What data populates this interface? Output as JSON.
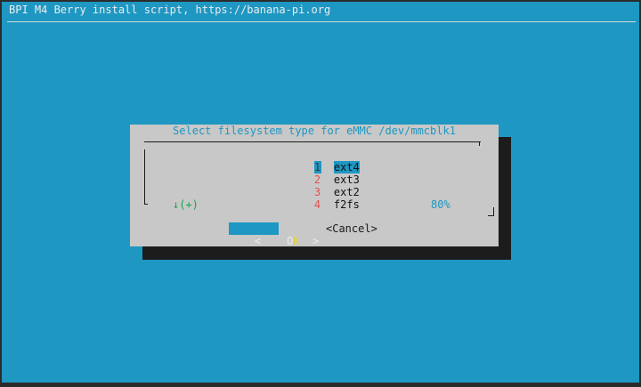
{
  "backtitle": "BPI M4 Berry install script, https://banana-pi.org",
  "dialog": {
    "title": "Select filesystem type for eMMC /dev/mmcblk1",
    "items": [
      {
        "tag": "1",
        "label": "ext4",
        "selected": true
      },
      {
        "tag": "2",
        "label": "ext3",
        "selected": false
      },
      {
        "tag": "3",
        "label": "ext2",
        "selected": false
      },
      {
        "tag": "4",
        "label": "f2fs",
        "selected": false
      }
    ],
    "scroll_indicator": "↓(+)",
    "scroll_percent": "80%",
    "buttons": {
      "ok_left": "<",
      "ok_pre": " ",
      "ok_hot": "O",
      "ok_rest": "K",
      "ok_right": ">",
      "cancel": "<Cancel>"
    }
  },
  "colors": {
    "background": "#1e97c2",
    "dialog": "#c8c8c8",
    "shadow": "#1c1c1c",
    "accent": "#1e97c2",
    "tag_color": "#e65050",
    "indicator": "#12a34c"
  }
}
